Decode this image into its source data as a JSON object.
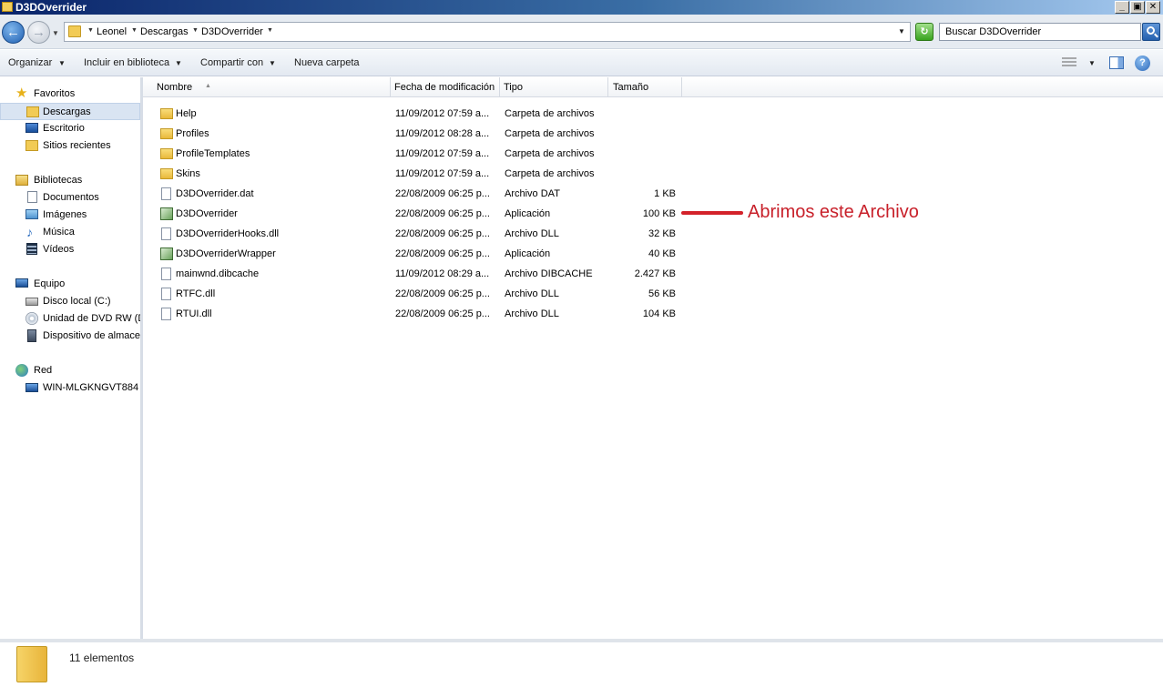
{
  "window": {
    "title": "D3DOverrider",
    "controls": {
      "minimize": "_",
      "maximize": "▣",
      "close": "✕"
    }
  },
  "address": {
    "crumbs": [
      "Leonel",
      "Descargas",
      "D3DOverrider"
    ],
    "search_placeholder": "Buscar D3DOverrider"
  },
  "toolbar": {
    "organize": "Organizar",
    "include_library": "Incluir en biblioteca",
    "share_with": "Compartir con",
    "new_folder": "Nueva carpeta",
    "help": "?"
  },
  "nav": {
    "favorites": "Favoritos",
    "downloads": "Descargas",
    "desktop": "Escritorio",
    "recent": "Sitios recientes",
    "libraries": "Bibliotecas",
    "documents": "Documentos",
    "images": "Imágenes",
    "music": "Música",
    "videos": "Vídeos",
    "computer": "Equipo",
    "local_disk": "Disco local (C:)",
    "dvd": "Unidad de DVD RW (D",
    "storage": "Dispositivo de almacen",
    "network": "Red",
    "host": "WIN-MLGKNGVT884"
  },
  "columns": {
    "name": "Nombre",
    "date": "Fecha de modificación",
    "type": "Tipo",
    "size": "Tamaño"
  },
  "files": [
    {
      "name": "Help",
      "date": "11/09/2012 07:59 a...",
      "type": "Carpeta de archivos",
      "size": "",
      "icon": "folder-icon"
    },
    {
      "name": "Profiles",
      "date": "11/09/2012 08:28 a...",
      "type": "Carpeta de archivos",
      "size": "",
      "icon": "folder-icon"
    },
    {
      "name": "ProfileTemplates",
      "date": "11/09/2012 07:59 a...",
      "type": "Carpeta de archivos",
      "size": "",
      "icon": "folder-icon"
    },
    {
      "name": "Skins",
      "date": "11/09/2012 07:59 a...",
      "type": "Carpeta de archivos",
      "size": "",
      "icon": "folder-icon"
    },
    {
      "name": "D3DOverrider.dat",
      "date": "22/08/2009 06:25 p...",
      "type": "Archivo DAT",
      "size": "1 KB",
      "icon": "file-icon"
    },
    {
      "name": "D3DOverrider",
      "date": "22/08/2009 06:25 p...",
      "type": "Aplicación",
      "size": "100 KB",
      "icon": "app-icon"
    },
    {
      "name": "D3DOverriderHooks.dll",
      "date": "22/08/2009 06:25 p...",
      "type": "Archivo DLL",
      "size": "32 KB",
      "icon": "file-icon"
    },
    {
      "name": "D3DOverriderWrapper",
      "date": "22/08/2009 06:25 p...",
      "type": "Aplicación",
      "size": "40 KB",
      "icon": "app-icon"
    },
    {
      "name": "mainwnd.dibcache",
      "date": "11/09/2012 08:29 a...",
      "type": "Archivo DIBCACHE",
      "size": "2.427 KB",
      "icon": "file-icon"
    },
    {
      "name": "RTFC.dll",
      "date": "22/08/2009 06:25 p...",
      "type": "Archivo DLL",
      "size": "56 KB",
      "icon": "file-icon"
    },
    {
      "name": "RTUI.dll",
      "date": "22/08/2009 06:25 p...",
      "type": "Archivo DLL",
      "size": "104 KB",
      "icon": "file-icon"
    }
  ],
  "annotation": {
    "text": "Abrimos este Archivo",
    "color": "#d3222a"
  },
  "status": {
    "count": "11 elementos"
  }
}
